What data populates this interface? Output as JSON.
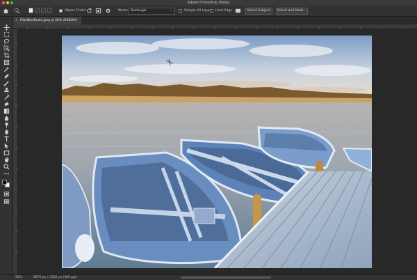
{
  "window": {
    "title": "Adobe Photoshop (Beta)"
  },
  "traffic_lights": {
    "close": "#ff5f57",
    "minimize": "#febc2e",
    "zoom": "#28c840"
  },
  "options_bar": {
    "object_finder_label": "Object Finder",
    "mode_label": "Mode:",
    "mode_value": "Rectangle",
    "sample_all_layers_label": "Sample All Layers",
    "hard_edge_label": "Hard Edge",
    "select_subject_label": "Select Subject",
    "select_and_mask_label": "Select and Mask..."
  },
  "document_tab": {
    "close_glyph": "×",
    "label": "FilbyBlueBoats.jpeg @ 50% (RGB/8#)"
  },
  "status_bar": {
    "zoom": "50%",
    "doc_info": "6670 px x 3332 px (300 ppi)"
  },
  "icons": {
    "tools": [
      "move-icon",
      "marquee-icon",
      "lasso-icon",
      "object-selection-icon",
      "crop-icon",
      "frame-icon",
      "eyedropper-icon",
      "healing-brush-icon",
      "brush-icon",
      "clone-stamp-icon",
      "history-brush-icon",
      "eraser-icon",
      "gradient-icon",
      "blur-icon",
      "dodge-icon",
      "pen-icon",
      "type-icon",
      "path-selection-icon",
      "rectangle-tool-icon",
      "hand-icon",
      "zoom-icon",
      "more-tools-icon"
    ]
  },
  "colors": {
    "foreground": "#111111",
    "background": "#ffffff",
    "ui_accent": "#3a3a3a"
  }
}
